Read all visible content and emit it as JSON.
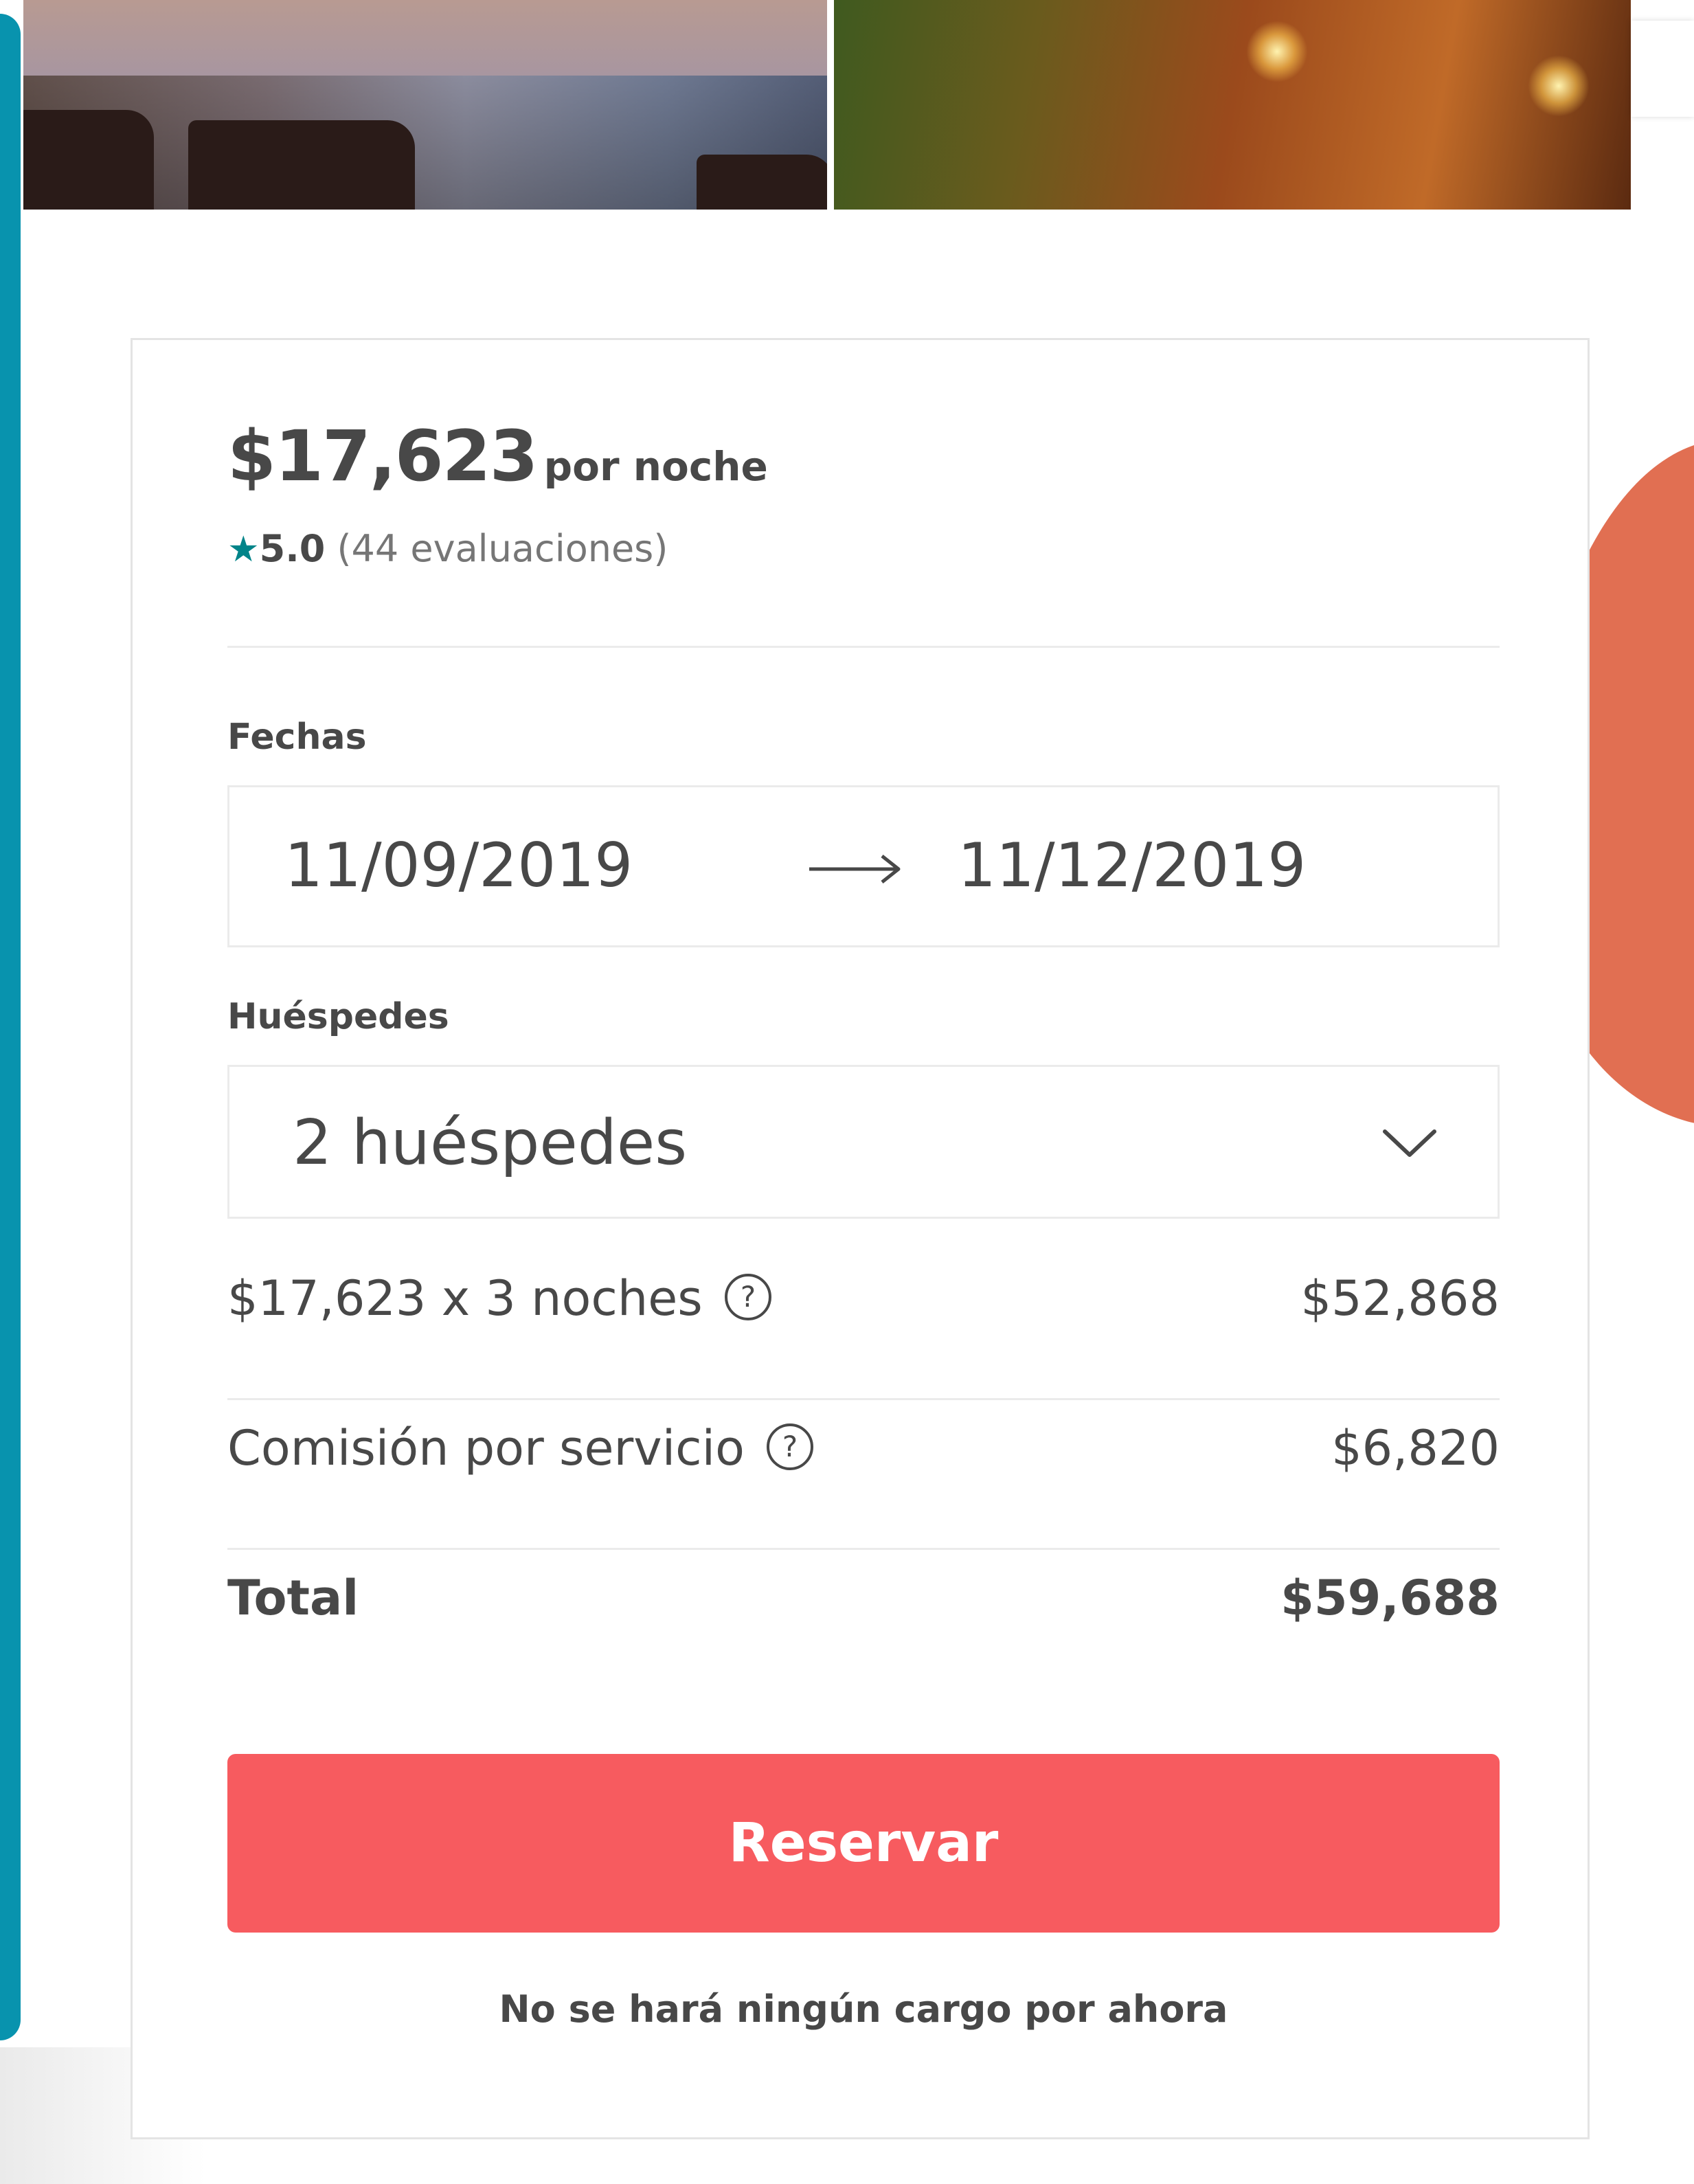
{
  "booking": {
    "price": "$17,623",
    "price_unit": "por noche",
    "rating": {
      "star_icon": "star-icon",
      "value": "5.0",
      "reviews": "(44 evaluaciones)"
    },
    "dates": {
      "label": "Fechas",
      "check_in": "11/09/2019",
      "check_out": "11/12/2019",
      "arrow_icon": "arrow-right-icon"
    },
    "guests": {
      "label": "Huéspedes",
      "value": "2 huéspedes",
      "icon": "chevron-down-icon"
    },
    "line_items": [
      {
        "label": "$17,623 x 3 noches",
        "amount": "$52,868",
        "help_icon": "question-circle-icon"
      },
      {
        "label": "Comisión por servicio",
        "amount": "$6,820",
        "help_icon": "question-circle-icon"
      }
    ],
    "total": {
      "label": "Total",
      "amount": "$59,688"
    },
    "reserve_label": "Reservar",
    "note": "No se hará ningún cargo por ahora"
  },
  "colors": {
    "accent": "#f75b5f",
    "star": "#008489",
    "text": "#484848",
    "muted": "#767676",
    "border": "#ebebeb",
    "decor_teal": "#0893ae",
    "decor_coral": "#e16f52"
  }
}
